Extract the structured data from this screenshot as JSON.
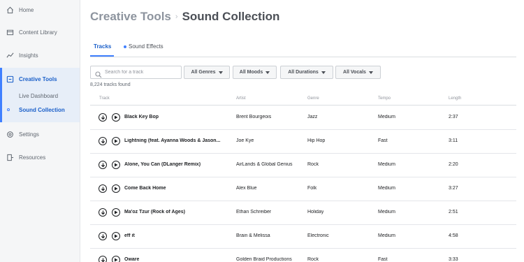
{
  "sidebar": {
    "items": [
      {
        "label": "Home",
        "icon": "home-icon"
      },
      {
        "label": "Content Library",
        "icon": "library-icon"
      },
      {
        "label": "Insights",
        "icon": "insights-icon"
      },
      {
        "label": "Creative Tools",
        "icon": "creative-tools-icon"
      },
      {
        "label": "Settings",
        "icon": "settings-icon"
      },
      {
        "label": "Resources",
        "icon": "resources-icon"
      }
    ],
    "sub_items": [
      {
        "label": "Live Dashboard"
      },
      {
        "label": "Sound Collection"
      }
    ]
  },
  "breadcrumb": {
    "parent": "Creative Tools",
    "separator": "›",
    "current": "Sound Collection"
  },
  "tabs": [
    {
      "label": "Tracks"
    },
    {
      "label": "Sound Effects"
    }
  ],
  "search": {
    "placeholder": "Search for a track",
    "value": ""
  },
  "filters": [
    {
      "label": "All Genres"
    },
    {
      "label": "All Moods"
    },
    {
      "label": "All Durations"
    },
    {
      "label": "All Vocals"
    }
  ],
  "result_count": "8,224 tracks found",
  "table": {
    "headers": [
      "Track",
      "Artist",
      "Genre",
      "Tempo",
      "Length"
    ],
    "rows": [
      {
        "track": "Black Key Bop",
        "artist": "Brent Bourgeois",
        "genre": "Jazz",
        "tempo": "Medium",
        "length": "2:37"
      },
      {
        "track": "Lightning (feat. Ayanna Woods & Jason...",
        "artist": "Joe Kye",
        "genre": "Hip Hop",
        "tempo": "Fast",
        "length": "3:11"
      },
      {
        "track": "Alone, You Can (DLanger Remix)",
        "artist": "AirLands & Global Genius",
        "genre": "Rock",
        "tempo": "Medium",
        "length": "2:20"
      },
      {
        "track": "Come Back Home",
        "artist": "Alex Blue",
        "genre": "Folk",
        "tempo": "Medium",
        "length": "3:27"
      },
      {
        "track": "Ma'oz Tzur (Rock of Ages)",
        "artist": "Ethan Schreiber",
        "genre": "Holiday",
        "tempo": "Medium",
        "length": "2:51"
      },
      {
        "track": "eff it",
        "artist": "Brain & Melissa",
        "genre": "Electronic",
        "tempo": "Medium",
        "length": "4:58"
      },
      {
        "track": "Oware",
        "artist": "Golden Braid Productions",
        "genre": "Rock",
        "tempo": "Fast",
        "length": "3:33"
      }
    ]
  },
  "colors": {
    "accent": "#4080ff",
    "active_text": "#1a5fc9",
    "sidebar_bg": "#f5f6f7",
    "active_bg": "#e7eef8"
  }
}
